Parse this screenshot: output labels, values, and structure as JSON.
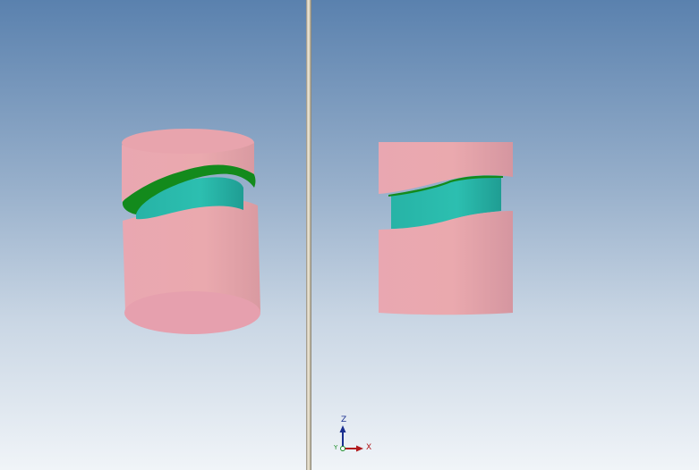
{
  "triad": {
    "z_label": "Z",
    "x_label": "X",
    "y_label": "Y"
  },
  "colors": {
    "background_top": "#5a81ae",
    "background_bottom": "#f0f4f8",
    "outer_part": "#e8a6ae",
    "inner_part": "#2ab5a8",
    "contact_face": "#138a1c",
    "splitter": "#d7cfb9",
    "axis_x": "#b1191c",
    "axis_y": "#1d8f2a",
    "axis_z": "#1a2f8f"
  },
  "icons": [
    "axis-triad-icon"
  ]
}
